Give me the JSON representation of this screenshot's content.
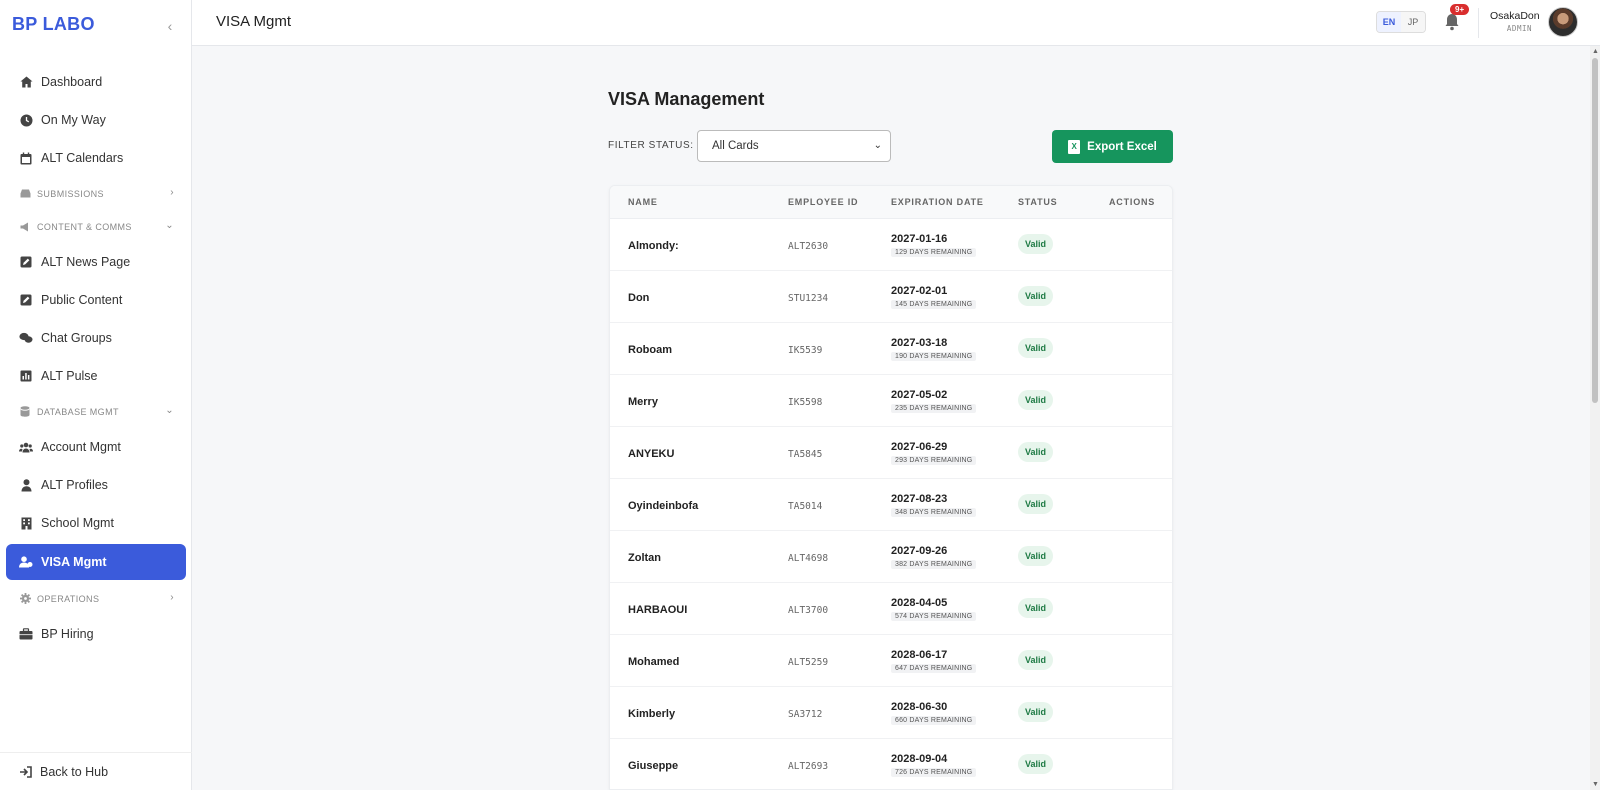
{
  "app": {
    "brand": "BP LABO",
    "collapse_icon": "chevron-left-icon"
  },
  "sidebar": {
    "items": [
      {
        "type": "item",
        "label": "Dashboard",
        "icon": "home-icon"
      },
      {
        "type": "item",
        "label": "On My Way",
        "icon": "clock-icon"
      },
      {
        "type": "item",
        "label": "ALT Calendars",
        "icon": "calendar-icon"
      },
      {
        "type": "section",
        "label": "SUBMISSIONS",
        "icon": "inbox-icon",
        "chevron": "chevron-right-icon"
      },
      {
        "type": "section",
        "label": "CONTENT & COMMS",
        "icon": "megaphone-icon",
        "chevron": "chevron-down-icon"
      },
      {
        "type": "item",
        "label": "ALT News Page",
        "icon": "edit-icon"
      },
      {
        "type": "item",
        "label": "Public Content",
        "icon": "edit-icon"
      },
      {
        "type": "item",
        "label": "Chat Groups",
        "icon": "chat-icon"
      },
      {
        "type": "item",
        "label": "ALT Pulse",
        "icon": "chart-icon"
      },
      {
        "type": "section",
        "label": "DATABASE MGMT",
        "icon": "database-icon",
        "chevron": "chevron-down-icon"
      },
      {
        "type": "item",
        "label": "Account Mgmt",
        "icon": "users-icon"
      },
      {
        "type": "item",
        "label": "ALT Profiles",
        "icon": "user-icon"
      },
      {
        "type": "item",
        "label": "School Mgmt",
        "icon": "building-icon"
      },
      {
        "type": "item",
        "label": "VISA Mgmt",
        "icon": "user-id-icon",
        "active": true
      },
      {
        "type": "section",
        "label": "OPERATIONS",
        "icon": "gear-icon",
        "chevron": "chevron-right-icon"
      },
      {
        "type": "item",
        "label": "BP Hiring",
        "icon": "briefcase-icon"
      }
    ],
    "back_label": "Back to Hub",
    "accent_color": "#3b5bdb"
  },
  "header": {
    "title": "VISA Mgmt",
    "lang_en": "EN",
    "lang_jp": "JP",
    "notification_count": "9+",
    "user_name": "OsakaDon",
    "user_role": "ADMIN"
  },
  "main": {
    "title": "VISA Management",
    "filter_label": "FILTER STATUS:",
    "filter_value": "All Cards",
    "export_label": "Export Excel",
    "export_color": "#16955d",
    "columns": [
      "NAME",
      "EMPLOYEE ID",
      "EXPIRATION DATE",
      "STATUS",
      "ACTIONS"
    ],
    "rows": [
      {
        "name": "Almondy:",
        "id": "ALT2630",
        "date": "2027-01-16",
        "days": "129 DAYS REMAINING",
        "status": "Valid"
      },
      {
        "name": "Don",
        "id": "STU1234",
        "date": "2027-02-01",
        "days": "145 DAYS REMAINING",
        "status": "Valid"
      },
      {
        "name": "Roboam",
        "id": "IK5539",
        "date": "2027-03-18",
        "days": "190 DAYS REMAINING",
        "status": "Valid"
      },
      {
        "name": "Merry",
        "id": "IK5598",
        "date": "2027-05-02",
        "days": "235 DAYS REMAINING",
        "status": "Valid"
      },
      {
        "name": "ANYEKU",
        "id": "TA5845",
        "date": "2027-06-29",
        "days": "293 DAYS REMAINING",
        "status": "Valid"
      },
      {
        "name": "Oyindeinbofa",
        "id": "TA5014",
        "date": "2027-08-23",
        "days": "348 DAYS REMAINING",
        "status": "Valid"
      },
      {
        "name": "Zoltan",
        "id": "ALT4698",
        "date": "2027-09-26",
        "days": "382 DAYS REMAINING",
        "status": "Valid"
      },
      {
        "name": "HARBAOUI",
        "id": "ALT3700",
        "date": "2028-04-05",
        "days": "574 DAYS REMAINING",
        "status": "Valid"
      },
      {
        "name": "Mohamed",
        "id": "ALT5259",
        "date": "2028-06-17",
        "days": "647 DAYS REMAINING",
        "status": "Valid"
      },
      {
        "name": "Kimberly",
        "id": "SA3712",
        "date": "2028-06-30",
        "days": "660 DAYS REMAINING",
        "status": "Valid"
      },
      {
        "name": "Giuseppe",
        "id": "ALT2693",
        "date": "2028-09-04",
        "days": "726 DAYS REMAINING",
        "status": "Valid"
      }
    ]
  }
}
